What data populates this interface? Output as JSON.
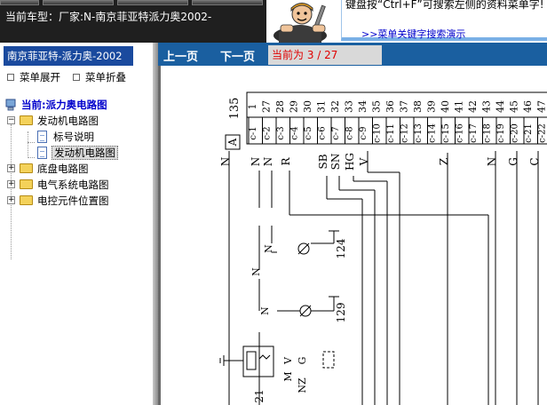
{
  "header": {
    "car_model_label": "当前车型：厂家:N-南京菲亚特派力奥2002-",
    "hint_text": "键盘按“Ctrl+F”可搜索左侧的资料菜单字!",
    "demo_link": ">>菜单关键字搜索演示"
  },
  "sidebar": {
    "title": "南京菲亚特-派力奥-2002",
    "expand_label": "菜单展开",
    "collapse_label": "菜单折叠",
    "current_label": "当前:派力奥电路图",
    "tree": [
      {
        "label": "发动机电路图",
        "expanded": true,
        "toggle": "−",
        "children": [
          {
            "label": "标号说明"
          },
          {
            "label": "发动机电路图",
            "selected": true
          }
        ]
      },
      {
        "label": "底盘电路图",
        "expanded": false,
        "toggle": "+"
      },
      {
        "label": "电气系统电路图",
        "expanded": false,
        "toggle": "+"
      },
      {
        "label": "电控元件位置图",
        "expanded": false,
        "toggle": "+"
      }
    ]
  },
  "toolbar": {
    "prev_label": "上一页",
    "next_label": "下一页",
    "page_indicator": "当前为 3 / 27"
  },
  "diagram": {
    "connector_id": "135",
    "connector_tag": "A",
    "pins": [
      "1",
      "27",
      "28",
      "29",
      "30",
      "31",
      "32",
      "33",
      "34",
      "35",
      "36",
      "37",
      "38",
      "39",
      "40",
      "41",
      "42",
      "43",
      "44",
      "45",
      "46",
      "47"
    ],
    "wire_colors": [
      "N",
      "N",
      "N",
      "R",
      "SB",
      "SN",
      "HG",
      "V",
      "Z",
      "N",
      "G",
      "C"
    ],
    "component_labels": [
      "124",
      "129",
      "21"
    ],
    "relay_labels": [
      "M",
      "V",
      "G",
      "NZ"
    ]
  },
  "colors": {
    "sidebar_title_bg": "#1a4a9e",
    "toolbar_bg": "#1a5fa0",
    "page_indicator_text": "#e00000",
    "link": "#0000cc"
  }
}
